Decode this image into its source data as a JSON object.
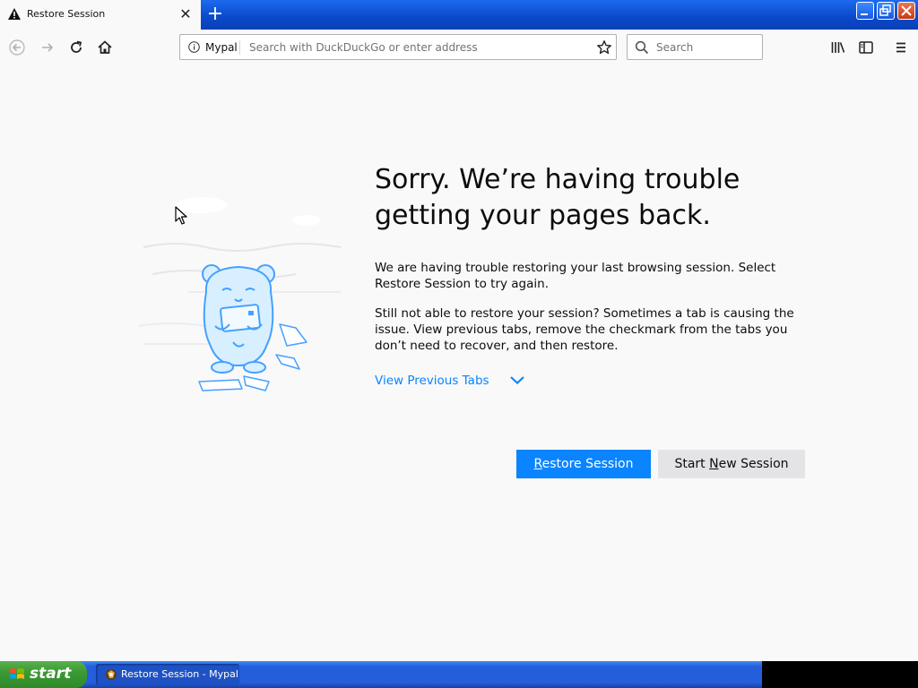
{
  "browser": {
    "tab_title": "Restore Session",
    "site_identity": "Mypal",
    "address_placeholder": "Search with DuckDuckGo or enter address",
    "search_placeholder": "Search"
  },
  "content": {
    "heading": "Sorry. We’re having trouble getting your pages back.",
    "paragraph1": "We are having trouble restoring your last browsing session. Select Restore Session to try again.",
    "paragraph2": "Still not able to restore your session? Sometimes a tab is causing the issue. View previous tabs, remove the checkmark from the tabs you don’t need to recover, and then restore.",
    "view_previous_tabs": "View Previous Tabs",
    "restore_button_pre": "",
    "restore_button_key": "R",
    "restore_button_post": "estore Session",
    "new_session_pre": "Start ",
    "new_session_key": "N",
    "new_session_post": "ew Session"
  },
  "taskbar": {
    "start_label": "start",
    "task_item_label": "Restore Session - Mypal"
  },
  "colors": {
    "accent": "#0a84ff",
    "titlebar": "#0a49c9",
    "taskbar": "#245edb"
  }
}
